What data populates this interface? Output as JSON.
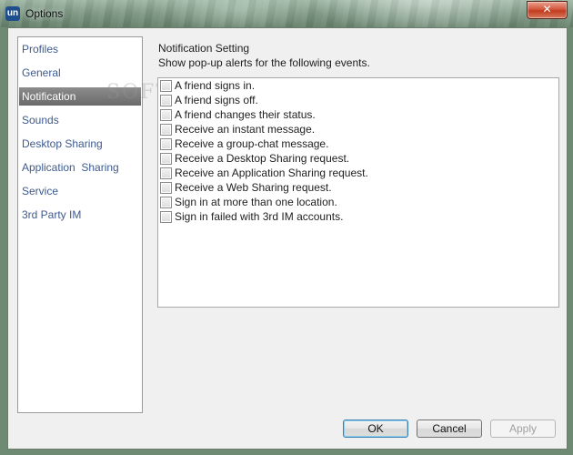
{
  "window": {
    "title": "Options",
    "icon": "un-logo-icon",
    "close_label": "✕"
  },
  "watermark": "SOFTPEDIA",
  "nav": {
    "items": [
      {
        "label": "Profiles"
      },
      {
        "label": "General"
      },
      {
        "label": "Notification",
        "selected": true
      },
      {
        "label": "Sounds"
      },
      {
        "label": "Desktop Sharing"
      },
      {
        "label": "Application  Sharing"
      },
      {
        "label": "Service"
      },
      {
        "label": "3rd Party IM"
      }
    ]
  },
  "content": {
    "title": "Notification Setting",
    "subtitle": "Show pop-up alerts for the following events.",
    "events": [
      {
        "label": "A friend signs in.",
        "checked": false
      },
      {
        "label": "A friend signs off.",
        "checked": false
      },
      {
        "label": "A friend changes their status.",
        "checked": false
      },
      {
        "label": "Receive an instant message.",
        "checked": false
      },
      {
        "label": "Receive a group-chat message.",
        "checked": false
      },
      {
        "label": "Receive a Desktop Sharing request.",
        "checked": false
      },
      {
        "label": "Receive an Application Sharing request.",
        "checked": false
      },
      {
        "label": "Receive a Web Sharing request.",
        "checked": false
      },
      {
        "label": "Sign in at more than one location.",
        "checked": false
      },
      {
        "label": "Sign in failed with 3rd IM accounts.",
        "checked": false
      }
    ]
  },
  "buttons": {
    "ok": "OK",
    "cancel": "Cancel",
    "apply": "Apply"
  },
  "colors": {
    "nav_text": "#3e5a8e",
    "nav_selected_bg": "#6a6a6a",
    "ok_focus_border": "#3c7fb1"
  }
}
